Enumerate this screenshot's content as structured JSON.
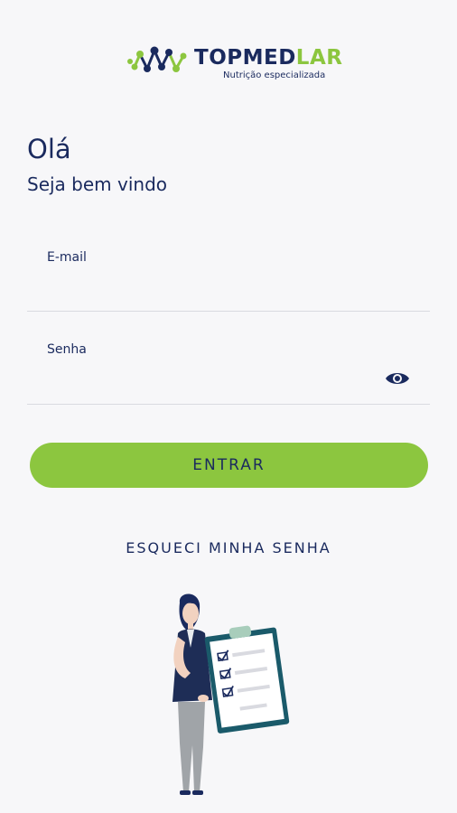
{
  "brand": {
    "name_part1": "TOPMED",
    "name_part2": "LAR",
    "tagline": "Nutrição especializada",
    "colors": {
      "navy": "#1a2a5e",
      "green": "#8cc63f"
    }
  },
  "greeting": {
    "title": "Olá",
    "subtitle": "Seja bem vindo"
  },
  "form": {
    "email_label": "E-mail",
    "email_value": "",
    "password_label": "Senha",
    "password_value": "",
    "show_password_icon": "eye-icon",
    "submit_label": "ENTRAR",
    "forgot_label": "ESQUECI MINHA SENHA"
  }
}
